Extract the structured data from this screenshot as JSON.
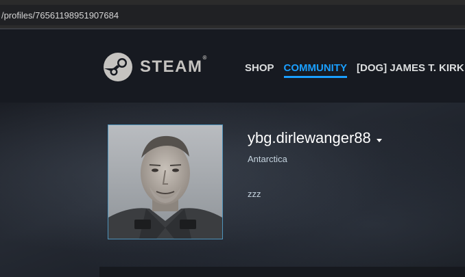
{
  "browser": {
    "url": "/profiles/76561198951907684"
  },
  "header": {
    "logo_text": "STEAM",
    "logo_tm": "®",
    "nav": [
      {
        "label": "SHOP",
        "active": false
      },
      {
        "label": "COMMUNITY",
        "active": true
      },
      {
        "label": "[DOG] JAMES T. KIRK",
        "active": false
      }
    ]
  },
  "profile": {
    "persona_name": "ybg.dirlewanger88",
    "location": "Antarctica",
    "summary": "zzz"
  },
  "colors": {
    "accent": "#1a9fff",
    "header_bg": "#171a21",
    "avatar_border": "#4f94bc"
  },
  "icons": {
    "logo": "steam-logo-icon",
    "caret": "caret-down-icon"
  }
}
